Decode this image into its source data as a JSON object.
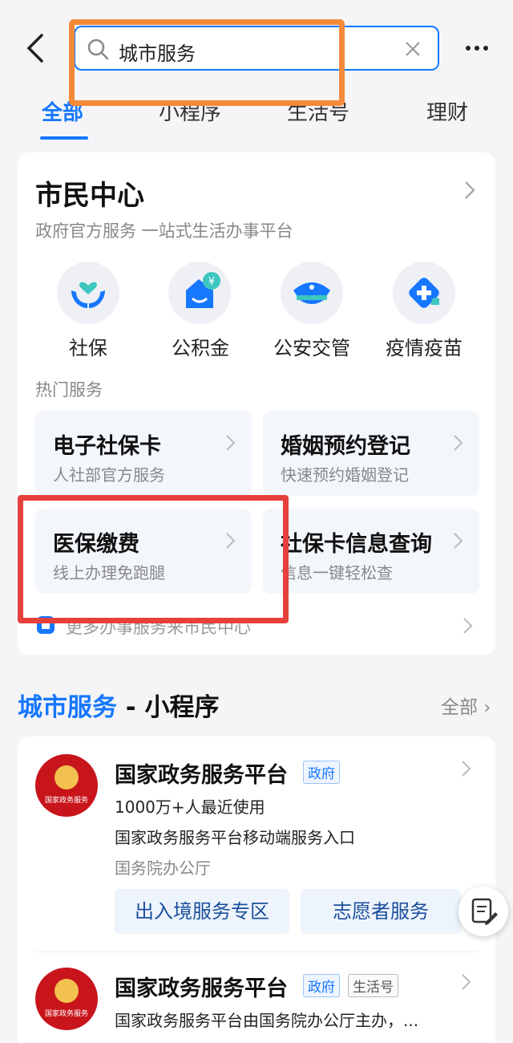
{
  "search": {
    "query": "城市服务"
  },
  "tabs": [
    "全部",
    "小程序",
    "生活号",
    "理财"
  ],
  "citizen_center": {
    "title": "市民中心",
    "subtitle": "政府官方服务 一站式生活办事平台",
    "icons": [
      {
        "label": "社保",
        "icon": "social-security-icon"
      },
      {
        "label": "公积金",
        "icon": "housing-fund-icon"
      },
      {
        "label": "公安交管",
        "icon": "police-cap-icon"
      },
      {
        "label": "疫情疫苗",
        "icon": "vaccine-icon"
      }
    ],
    "hot_label": "热门服务",
    "hot": [
      {
        "title": "电子社保卡",
        "sub": "人社部官方服务"
      },
      {
        "title": "婚姻预约登记",
        "sub": "快速预约婚姻登记"
      },
      {
        "title": "医保缴费",
        "sub": "线上办理免跑腿"
      },
      {
        "title": "社保卡信息查询",
        "sub": "信息一键轻松查"
      }
    ],
    "more": "更多办事服务来市民中心"
  },
  "section": {
    "highlight": "城市服务",
    "rest": " - 小程序",
    "all": "全部"
  },
  "programs": [
    {
      "title": "国家政务服务平台",
      "tags": [
        "政府"
      ],
      "logo_text": "国家政务服务",
      "lines": [
        "1000万+人最近使用",
        "国家政务服务平台移动端服务入口",
        "国务院办公厅"
      ],
      "buttons": [
        "出入境服务专区",
        "志愿者服务"
      ]
    },
    {
      "title": "国家政务服务平台",
      "tags": [
        "政府",
        "生活号"
      ],
      "logo_text": "国家政务服务",
      "lines": [
        "国家政务服务平台由国务院办公厅主办，..."
      ]
    }
  ],
  "colors": {
    "accent": "#1677ff",
    "highlight_orange": "#f5893a",
    "highlight_red": "#e5403b"
  }
}
